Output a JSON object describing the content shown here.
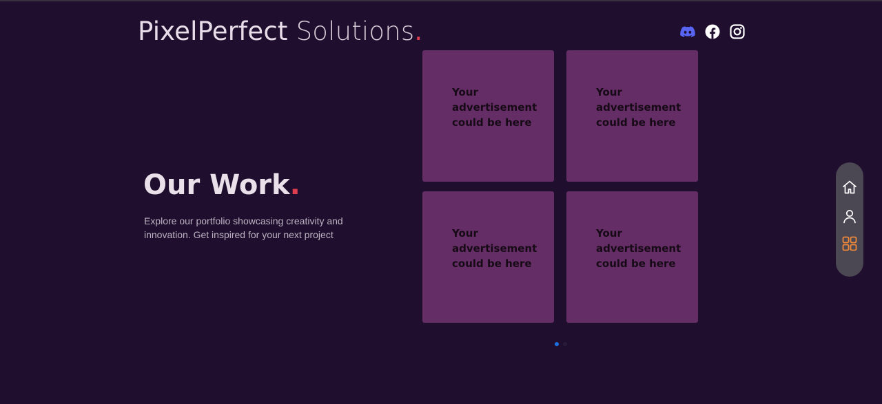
{
  "header": {
    "brand_main": "PixelPerfect",
    "brand_secondary": "Solutions",
    "brand_dot": "."
  },
  "socials": [
    {
      "icon": "discord-icon",
      "color": "#5865f2"
    },
    {
      "icon": "facebook-icon",
      "color": "#ffffff"
    },
    {
      "icon": "instagram-icon",
      "color": "#ffffff"
    }
  ],
  "hero": {
    "title": "Our Work",
    "title_dot": ".",
    "description": "Explore our portfolio showcasing creativity and innovation. Get inspired for your next project"
  },
  "ads": [
    {
      "text": "Your advertisement could be here"
    },
    {
      "text": "Your advertisement could be here"
    },
    {
      "text": "Your advertisement could be here"
    },
    {
      "text": "Your advertisement could be here"
    }
  ],
  "pagination": {
    "current_page": 1,
    "total_pages": 2,
    "active_color": "#1e6fe0",
    "inactive_color": "#2a1a3a"
  },
  "side_nav": [
    {
      "icon": "home-icon",
      "active": false
    },
    {
      "icon": "user-icon",
      "active": false
    },
    {
      "icon": "grid-icon",
      "active": true
    }
  ],
  "colors": {
    "background": "#1f0e2e",
    "card": "#652d65",
    "accent_dot": "#e13f4f",
    "nav_active": "#f08a3a",
    "nav_inactive": "#ffffff"
  }
}
